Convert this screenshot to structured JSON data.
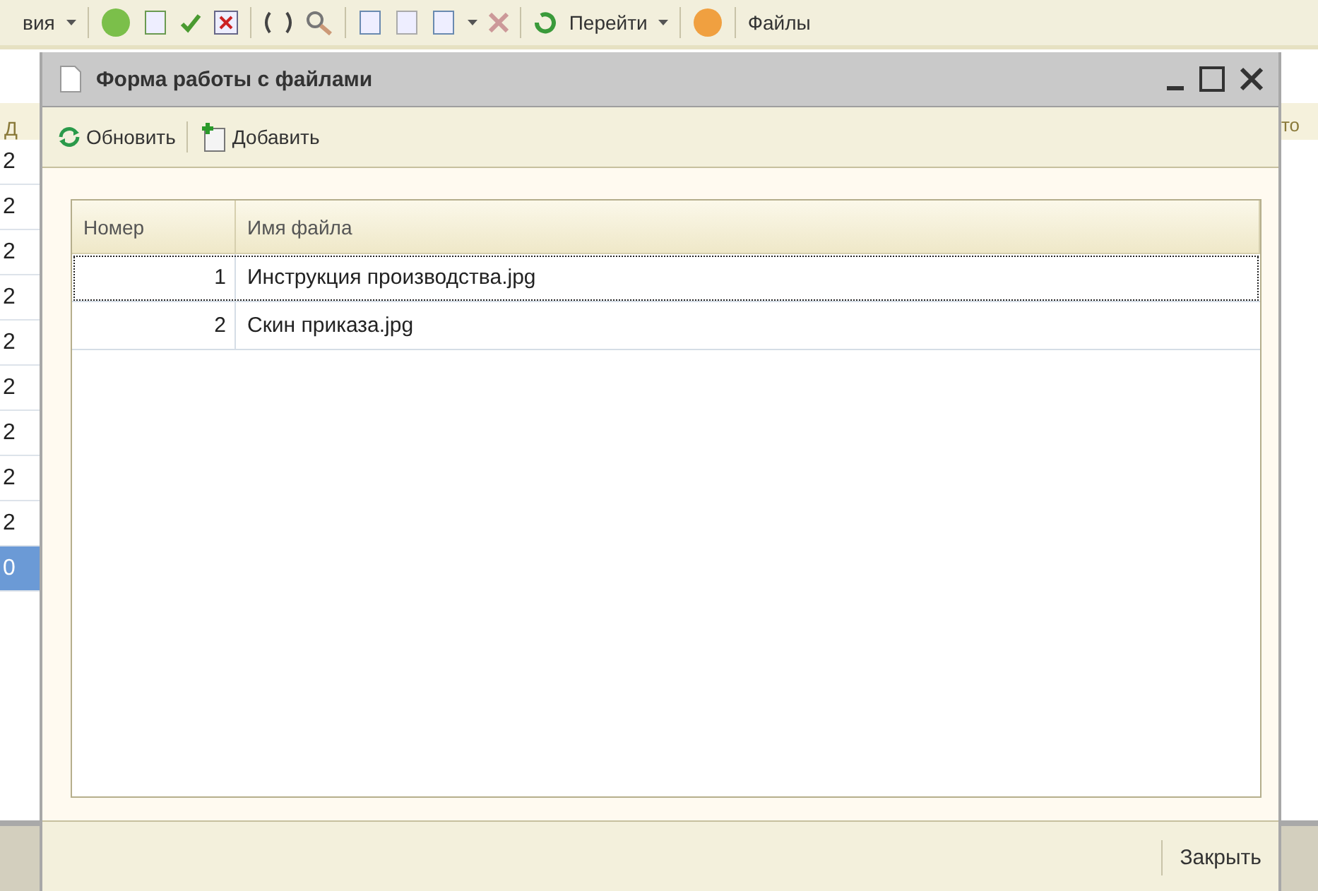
{
  "app_toolbar": {
    "labels": [
      "вия",
      "Перейти",
      "Файлы"
    ]
  },
  "left_column": {
    "header": "Д",
    "rows": [
      {
        "text": "2",
        "selected": false
      },
      {
        "text": "2",
        "selected": false
      },
      {
        "text": "2",
        "selected": false
      },
      {
        "text": "2",
        "selected": false
      },
      {
        "text": "2",
        "selected": false
      },
      {
        "text": "2",
        "selected": false
      },
      {
        "text": "2",
        "selected": false
      },
      {
        "text": "2",
        "selected": false
      },
      {
        "text": "2",
        "selected": false
      },
      {
        "text": "0",
        "selected": true
      }
    ]
  },
  "right_column": {
    "header": "то"
  },
  "dialog": {
    "title": "Форма работы с файлами",
    "toolbar": [
      {
        "kind": "refresh",
        "label": "Обновить"
      },
      {
        "kind": "add",
        "label": "Добавить"
      }
    ],
    "table": {
      "columns": [
        "Номер",
        "Имя файла"
      ],
      "rows": [
        {
          "number": "1",
          "name": "Инструкция производства.jpg",
          "selected": true
        },
        {
          "number": "2",
          "name": "Скин приказа.jpg",
          "selected": false
        }
      ]
    },
    "footer": {
      "close_button": "Закрыть"
    }
  }
}
